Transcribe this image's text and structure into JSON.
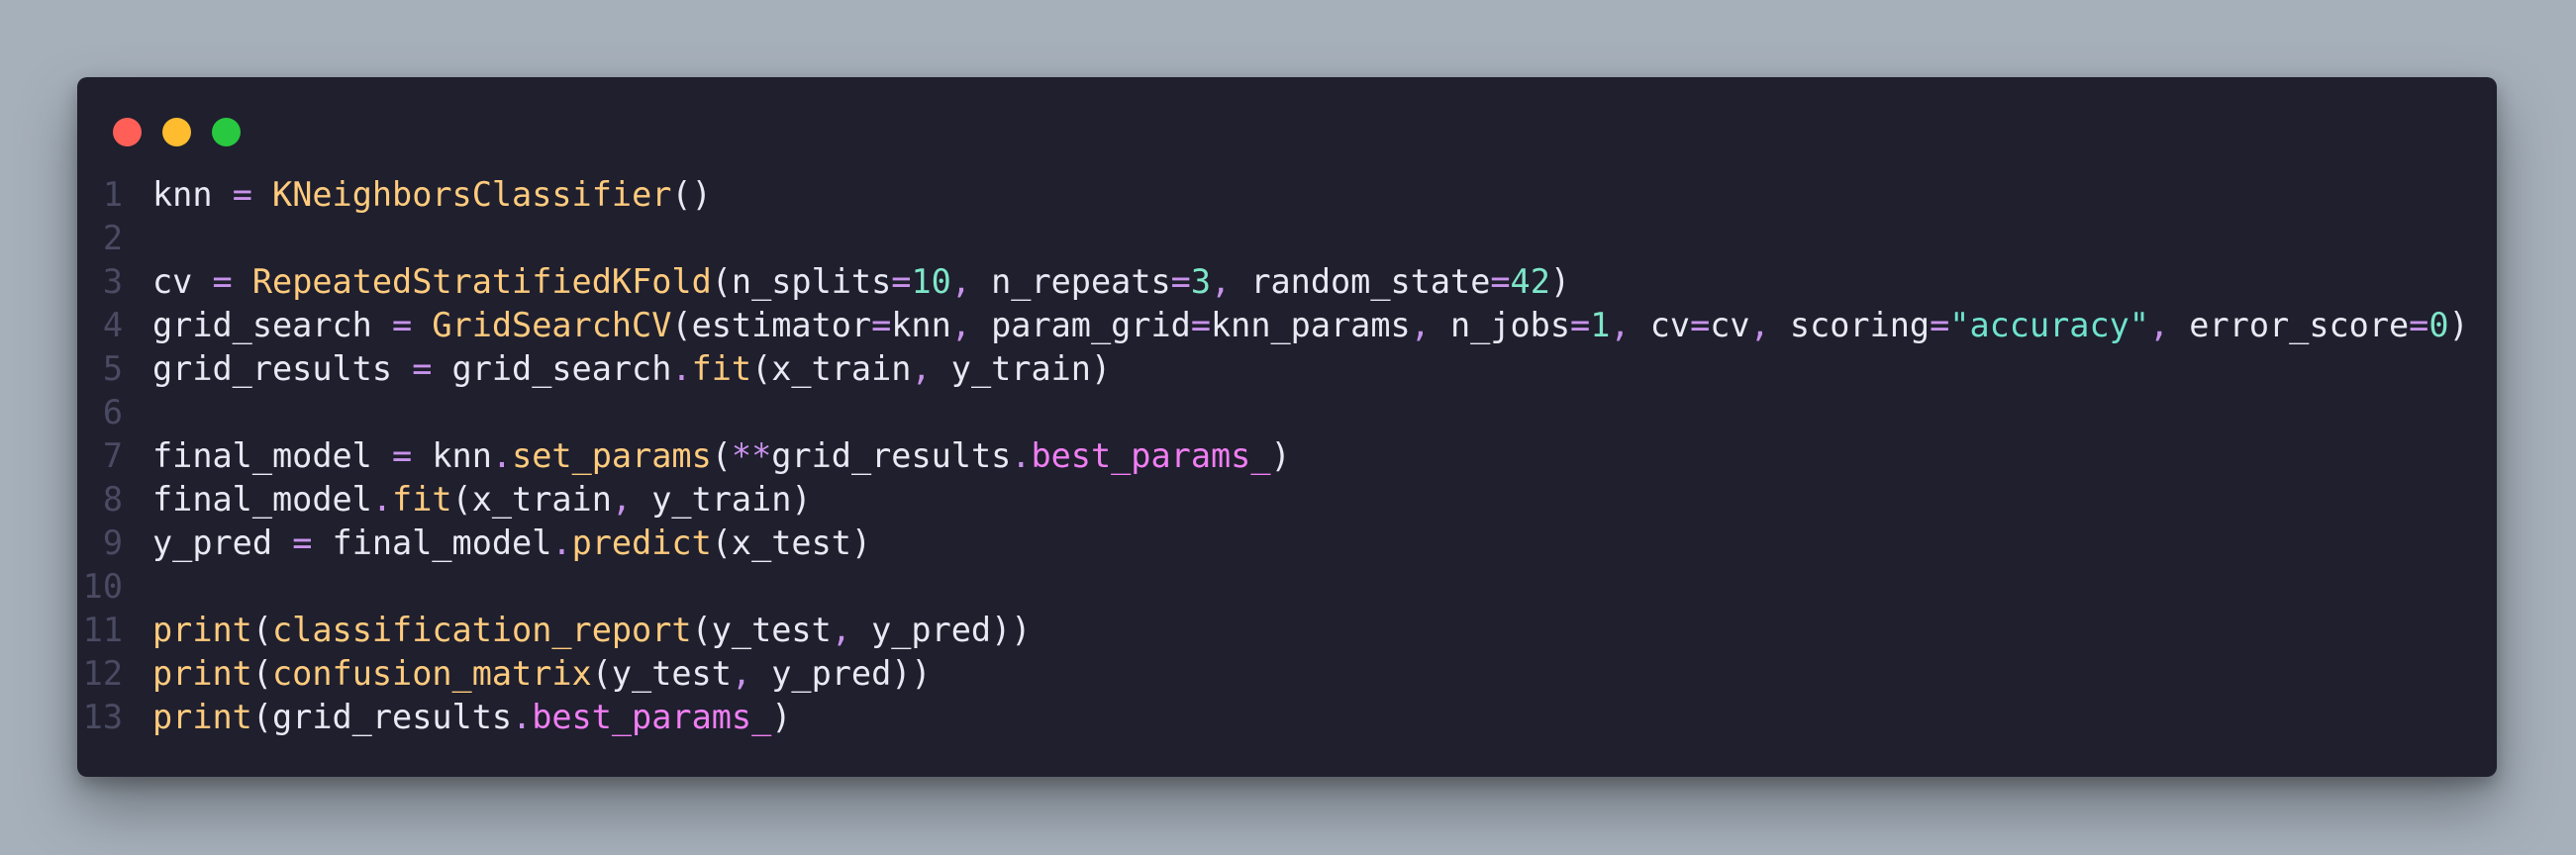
{
  "window": {
    "controls": [
      {
        "name": "close",
        "color": "#ff5f57"
      },
      {
        "name": "minimize",
        "color": "#febc2e"
      },
      {
        "name": "maximize",
        "color": "#28c840"
      }
    ]
  },
  "palette": {
    "text": "#e9e9f4",
    "operator": "#c792ea",
    "function": "#ffcb7d",
    "number": "#7ee6c8",
    "string": "#6fe3cc",
    "attribute": "#f07ef2",
    "line_number": "#4a4a62",
    "background": "#1f1f2e"
  },
  "code": {
    "lines": [
      {
        "n": "1",
        "tokens": [
          [
            "knn ",
            "t"
          ],
          [
            "=",
            "o"
          ],
          [
            " ",
            "t"
          ],
          [
            "KNeighborsClassifier",
            "f"
          ],
          [
            "()",
            "t"
          ]
        ]
      },
      {
        "n": "2",
        "tokens": []
      },
      {
        "n": "3",
        "tokens": [
          [
            "cv ",
            "t"
          ],
          [
            "=",
            "o"
          ],
          [
            " ",
            "t"
          ],
          [
            "RepeatedStratifiedKFold",
            "f"
          ],
          [
            "(n_splits",
            "t"
          ],
          [
            "=",
            "o"
          ],
          [
            "10",
            "n"
          ],
          [
            ",",
            "o"
          ],
          [
            " n_repeats",
            "t"
          ],
          [
            "=",
            "o"
          ],
          [
            "3",
            "n"
          ],
          [
            ",",
            "o"
          ],
          [
            " random_state",
            "t"
          ],
          [
            "=",
            "o"
          ],
          [
            "42",
            "n"
          ],
          [
            ")",
            "t"
          ]
        ]
      },
      {
        "n": "4",
        "tokens": [
          [
            "grid_search ",
            "t"
          ],
          [
            "=",
            "o"
          ],
          [
            " ",
            "t"
          ],
          [
            "GridSearchCV",
            "f"
          ],
          [
            "(estimator",
            "t"
          ],
          [
            "=",
            "o"
          ],
          [
            "knn",
            "t"
          ],
          [
            ",",
            "o"
          ],
          [
            " param_grid",
            "t"
          ],
          [
            "=",
            "o"
          ],
          [
            "knn_params",
            "t"
          ],
          [
            ",",
            "o"
          ],
          [
            " n_jobs",
            "t"
          ],
          [
            "=",
            "o"
          ],
          [
            "1",
            "n"
          ],
          [
            ",",
            "o"
          ],
          [
            " cv",
            "t"
          ],
          [
            "=",
            "o"
          ],
          [
            "cv",
            "t"
          ],
          [
            ",",
            "o"
          ],
          [
            " scoring",
            "t"
          ],
          [
            "=",
            "o"
          ],
          [
            "\"accuracy\"",
            "s"
          ],
          [
            ",",
            "o"
          ],
          [
            " error_score",
            "t"
          ],
          [
            "=",
            "o"
          ],
          [
            "0",
            "n"
          ],
          [
            ")",
            "t"
          ]
        ]
      },
      {
        "n": "5",
        "tokens": [
          [
            "grid_results ",
            "t"
          ],
          [
            "=",
            "o"
          ],
          [
            " grid_search",
            "t"
          ],
          [
            ".",
            "o"
          ],
          [
            "fit",
            "f"
          ],
          [
            "(x_train",
            "t"
          ],
          [
            ",",
            "o"
          ],
          [
            " y_train)",
            "t"
          ]
        ]
      },
      {
        "n": "6",
        "tokens": []
      },
      {
        "n": "7",
        "tokens": [
          [
            "final_model ",
            "t"
          ],
          [
            "=",
            "o"
          ],
          [
            " knn",
            "t"
          ],
          [
            ".",
            "o"
          ],
          [
            "set_params",
            "f"
          ],
          [
            "(",
            "t"
          ],
          [
            "**",
            "o"
          ],
          [
            "grid_results",
            "t"
          ],
          [
            ".",
            "o"
          ],
          [
            "best_params_",
            "a"
          ],
          [
            ")",
            "t"
          ]
        ]
      },
      {
        "n": "8",
        "tokens": [
          [
            "final_model",
            "t"
          ],
          [
            ".",
            "o"
          ],
          [
            "fit",
            "f"
          ],
          [
            "(x_train",
            "t"
          ],
          [
            ",",
            "o"
          ],
          [
            " y_train)",
            "t"
          ]
        ]
      },
      {
        "n": "9",
        "tokens": [
          [
            "y_pred ",
            "t"
          ],
          [
            "=",
            "o"
          ],
          [
            " final_model",
            "t"
          ],
          [
            ".",
            "o"
          ],
          [
            "predict",
            "f"
          ],
          [
            "(x_test)",
            "t"
          ]
        ]
      },
      {
        "n": "10",
        "tokens": []
      },
      {
        "n": "11",
        "tokens": [
          [
            "print",
            "f"
          ],
          [
            "(",
            "t"
          ],
          [
            "classification_report",
            "f"
          ],
          [
            "(y_test",
            "t"
          ],
          [
            ",",
            "o"
          ],
          [
            " y_pred))",
            "t"
          ]
        ]
      },
      {
        "n": "12",
        "tokens": [
          [
            "print",
            "f"
          ],
          [
            "(",
            "t"
          ],
          [
            "confusion_matrix",
            "f"
          ],
          [
            "(y_test",
            "t"
          ],
          [
            ",",
            "o"
          ],
          [
            " y_pred))",
            "t"
          ]
        ]
      },
      {
        "n": "13",
        "tokens": [
          [
            "print",
            "f"
          ],
          [
            "(grid_results",
            "t"
          ],
          [
            ".",
            "o"
          ],
          [
            "best_params_",
            "a"
          ],
          [
            ")",
            "t"
          ]
        ]
      }
    ]
  }
}
